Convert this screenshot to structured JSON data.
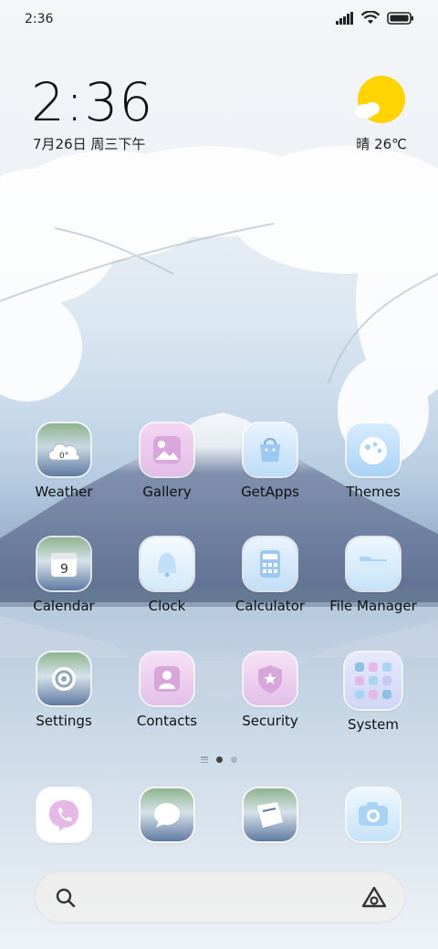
{
  "status_bar": {
    "time": "2:36"
  },
  "home_widget": {
    "time": "2:36",
    "date": "7月26日 周三下午",
    "weather": "晴 26℃"
  },
  "apps": [
    {
      "label": "Weather",
      "icon": "weather-icon"
    },
    {
      "label": "Gallery",
      "icon": "gallery-icon"
    },
    {
      "label": "GetApps",
      "icon": "getapps-icon"
    },
    {
      "label": "Themes",
      "icon": "themes-icon"
    },
    {
      "label": "Calendar",
      "icon": "calendar-icon",
      "badge": "9"
    },
    {
      "label": "Clock",
      "icon": "clock-icon"
    },
    {
      "label": "Calculator",
      "icon": "calculator-icon"
    },
    {
      "label": "File Manager",
      "icon": "file-manager-icon"
    },
    {
      "label": "Settings",
      "icon": "settings-icon"
    },
    {
      "label": "Contacts",
      "icon": "contacts-icon"
    },
    {
      "label": "Security",
      "icon": "security-icon"
    },
    {
      "label": "System",
      "icon": "system-folder-icon"
    }
  ],
  "dock": [
    {
      "icon": "phone-icon"
    },
    {
      "icon": "messages-icon"
    },
    {
      "icon": "browser-icon"
    },
    {
      "icon": "camera-icon"
    }
  ],
  "search": {
    "icon": "search-icon",
    "assistant_icon": "assistant-icon"
  },
  "colors": {
    "sun": "#FFD400",
    "accent_pink": "#E7C3EA",
    "accent_blue": "#A9D3F4"
  }
}
